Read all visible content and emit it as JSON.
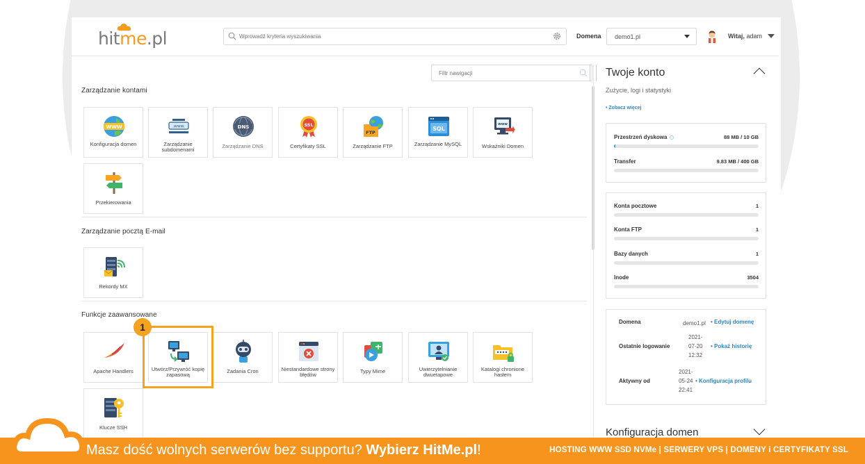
{
  "header": {
    "logo_hit": "hit",
    "logo_me": "me",
    "logo_pl": ".pl",
    "search_placeholder": "Wprowadź kryteria wyszukiwania",
    "domain_label": "Domena",
    "domain_value": "demo1.pl",
    "greeting": "Witaj,",
    "username": "adam"
  },
  "left": {
    "filter_placeholder": "Filtr nawigacji",
    "sections": [
      {
        "title": "Zarządzanie kontami",
        "tiles": [
          {
            "label": "Konfiguracja domen",
            "icon": "www-globe-icon"
          },
          {
            "label": "Zarządzanie subdomenami",
            "icon": "subdomain-icon"
          },
          {
            "label": "Zarządzanie DNS",
            "icon": "dns-icon"
          },
          {
            "label": "Certyfikaty SSL",
            "icon": "ssl-certificate-icon"
          },
          {
            "label": "Zarządzanie FTP",
            "icon": "ftp-folder-icon"
          },
          {
            "label": "Zarządzanie MySQL",
            "icon": "sql-database-icon"
          },
          {
            "label": "Wskaźniki Domen",
            "icon": "domain-pointer-icon"
          },
          {
            "label": "Przekierowania",
            "icon": "signpost-icon"
          }
        ]
      },
      {
        "title": "Zarządzanie pocztą E-mail",
        "tiles": [
          {
            "label": "Rekordy MX",
            "icon": "mx-server-icon"
          }
        ]
      },
      {
        "title": "Funkcje zaawansowane",
        "tiles": [
          {
            "label": "Apache Handlers",
            "icon": "apache-feather-icon"
          },
          {
            "label": "Utwórz/Przywróć kopię zapasową",
            "icon": "backup-icon"
          },
          {
            "label": "Zadania Cron",
            "icon": "cron-robot-icon"
          },
          {
            "label": "Niestandardowe strony błędów",
            "icon": "error-page-icon"
          },
          {
            "label": "Typy Mime",
            "icon": "mime-types-icon"
          },
          {
            "label": "Uwierzytelnianie dwuetapowe",
            "icon": "two-factor-icon"
          },
          {
            "label": "Katalogi chronione hasłem",
            "icon": "password-folder-icon"
          },
          {
            "label": "Klucze SSH",
            "icon": "ssh-key-icon"
          }
        ]
      }
    ],
    "highlight_number": "1"
  },
  "right": {
    "title": "Twoje konto",
    "subtitle": "Zużycie, logi i statystyki",
    "see_more": "• Zobacz więcej",
    "usage": [
      {
        "name": "Przestrzeń dyskowa",
        "value": "88 MB / 10 GB",
        "fill": 0.01
      },
      {
        "name": "Transfer",
        "value": "9.83 MB / 400 GB",
        "fill": 0.0
      }
    ],
    "counts": [
      {
        "name": "Konta pocztowe",
        "value": "1",
        "fill": 0.0
      },
      {
        "name": "Konta FTP",
        "value": "1",
        "fill": 0.0
      },
      {
        "name": "Bazy danych",
        "value": "1",
        "fill": 0.0
      },
      {
        "name": "Inode",
        "value": "3504",
        "fill": 0.0
      }
    ],
    "info": {
      "domain_key": "Domena",
      "domain_val": "demo1.pl",
      "domain_link": "• Edytuj domenę",
      "last_login_key": "Ostatnie logowanie",
      "last_login_val": "2021-07-20 12:32",
      "last_login_link": "• Pokaż historię",
      "active_key": "Aktywny od",
      "active_val": "2021-05-24 22:41",
      "active_link": "• Konfiguracja profilu"
    },
    "domains_config": "Konfiguracja domen"
  },
  "banner": {
    "slogan_prefix": "Masz dość wolnych serwerów bez supportu?",
    "slogan_bold": "Wybierz HitMe.pl",
    "slogan_suffix": "!",
    "services": "HOSTING WWW SSD NVMe | SERWERY VPS | DOMENY i CERTYFIKATY SSL"
  },
  "colors": {
    "accent": "#f4a21f",
    "banner": "#f7941d",
    "link": "#2d84c8",
    "bar": "#3a9ad9"
  }
}
